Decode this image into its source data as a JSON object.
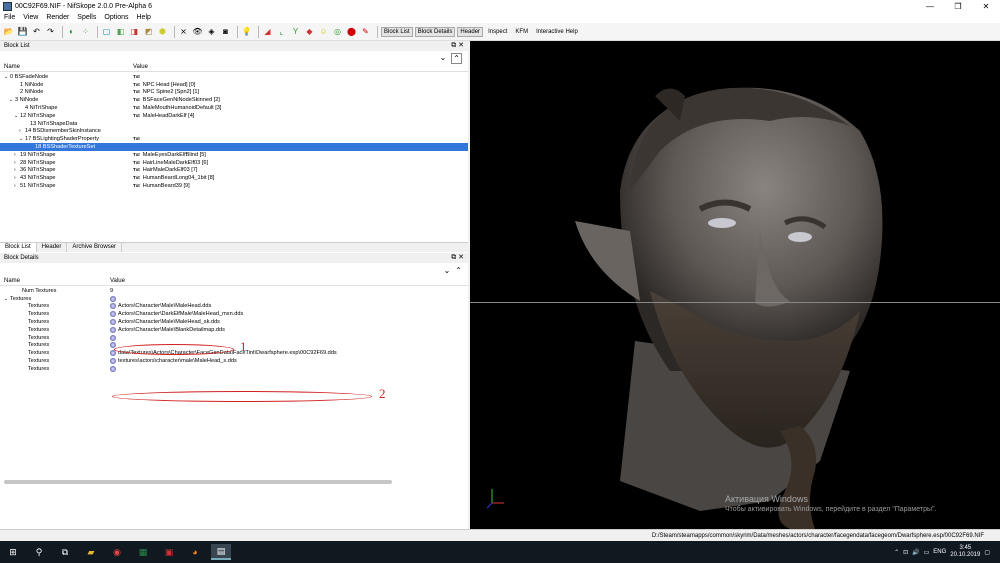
{
  "window": {
    "title": "00C92F69.NIF - NifSkope 2.0.0 Pre-Alpha 6"
  },
  "menu": [
    "File",
    "View",
    "Render",
    "Spells",
    "Options",
    "Help"
  ],
  "toolbar_text": [
    "Block List",
    "Block Details",
    "Header",
    "Inspect",
    "KFM",
    "Interactive Help"
  ],
  "block_list": {
    "title": "Block List",
    "col_name": "Name",
    "col_value": "Value",
    "rows": [
      {
        "indent": 0,
        "arrow": "v",
        "name": "0 BSFadeNode",
        "tag": "Txt",
        "value": ""
      },
      {
        "indent": 2,
        "arrow": "",
        "name": "1 NiNode",
        "tag": "Txt",
        "value": "NPC Head [Head] [0]"
      },
      {
        "indent": 2,
        "arrow": "",
        "name": "2 NiNode",
        "tag": "Txt",
        "value": "NPC Spine2 [Spn2] [1]"
      },
      {
        "indent": 1,
        "arrow": "v",
        "name": "3 NiNode",
        "tag": "Txt",
        "value": "BSFaceGenNiNodeSkinned [2]"
      },
      {
        "indent": 3,
        "arrow": "",
        "name": "4 NiTriShape",
        "tag": "Txt",
        "value": "MaleMouthHumanoidDefault [3]"
      },
      {
        "indent": 2,
        "arrow": "v",
        "name": "12 NiTriShape",
        "tag": "Txt",
        "value": "MaleHeadDarkElf [4]"
      },
      {
        "indent": 4,
        "arrow": "",
        "name": "13 NiTriShapeData",
        "tag": "",
        "value": ""
      },
      {
        "indent": 3,
        "arrow": ">",
        "name": "14 BSDismemberSkinInstance",
        "tag": "",
        "value": ""
      },
      {
        "indent": 3,
        "arrow": "v",
        "name": "17 BSLightingShaderProperty",
        "tag": "Txt",
        "value": ""
      },
      {
        "indent": 5,
        "arrow": "",
        "name": "18 BSShaderTextureSet",
        "tag": "",
        "value": "",
        "selected": true
      },
      {
        "indent": 2,
        "arrow": ">",
        "name": "19 NiTriShape",
        "tag": "Txt",
        "value": "MaleEyesDarkElfBlind [5]"
      },
      {
        "indent": 2,
        "arrow": ">",
        "name": "28 NiTriShape",
        "tag": "Txt",
        "value": "HairLineMaleDarkElf03 [6]"
      },
      {
        "indent": 2,
        "arrow": ">",
        "name": "36 NiTriShape",
        "tag": "Txt",
        "value": "HairMaleDarkElf03 [7]"
      },
      {
        "indent": 2,
        "arrow": ">",
        "name": "43 NiTriShape",
        "tag": "Txt",
        "value": "HumanBeardLong04_1bit [8]"
      },
      {
        "indent": 2,
        "arrow": ">",
        "name": "51 NiTriShape",
        "tag": "Txt",
        "value": "HumanBeard39 [9]"
      }
    ]
  },
  "tabs": [
    "Block List",
    "Header",
    "Archive Browser"
  ],
  "block_details": {
    "title": "Block Details",
    "col_name": "Name",
    "col_value": "Value",
    "rows": [
      {
        "indent": 2,
        "arrow": "",
        "name": "Num Textures",
        "icon": false,
        "value": "9"
      },
      {
        "indent": 0,
        "arrow": "v",
        "name": "Textures",
        "icon": true,
        "value": ""
      },
      {
        "indent": 3,
        "arrow": "",
        "name": "Textures",
        "icon": true,
        "value": "Actors\\Character\\Male\\MaleHead.dds"
      },
      {
        "indent": 3,
        "arrow": "",
        "name": "Textures",
        "icon": true,
        "value": "Actors\\Character\\DarkElfMale\\MaleHead_msn.dds"
      },
      {
        "indent": 3,
        "arrow": "",
        "name": "Textures",
        "icon": true,
        "value": "Actors\\Character\\Male\\MaleHead_sk.dds"
      },
      {
        "indent": 3,
        "arrow": "",
        "name": "Textures",
        "icon": true,
        "value": "Actors\\Character\\Male\\BlankDetailmap.dds"
      },
      {
        "indent": 3,
        "arrow": "",
        "name": "Textures",
        "icon": true,
        "value": ""
      },
      {
        "indent": 3,
        "arrow": "",
        "name": "Textures",
        "icon": true,
        "value": ""
      },
      {
        "indent": 3,
        "arrow": "",
        "name": "Textures",
        "icon": true,
        "value": "data\\Textures\\Actors\\Character\\FaceGenData\\FaceTint\\Dwarfsphere.esp\\00C92F69.dds"
      },
      {
        "indent": 3,
        "arrow": "",
        "name": "Textures",
        "icon": true,
        "value": "textures\\actors\\character\\male\\MaleHead_s.dds"
      },
      {
        "indent": 3,
        "arrow": "",
        "name": "Textures",
        "icon": true,
        "value": ""
      }
    ],
    "annotations": [
      "1",
      "2"
    ]
  },
  "viewport": {
    "watermark_title": "Активация Windows",
    "watermark_text": "Чтобы активировать Windows, перейдите в раздел \"Параметры\"."
  },
  "statusbar": {
    "path": "D:/Steam/steamapps/common/skyrim/Data/meshes/actors/character/facegendata/facegeom/Dwarfsphere.esp/00C92F69.NIF"
  },
  "taskbar": {
    "lang": "ENG",
    "time": "3:45",
    "date": "20.10.2019"
  }
}
